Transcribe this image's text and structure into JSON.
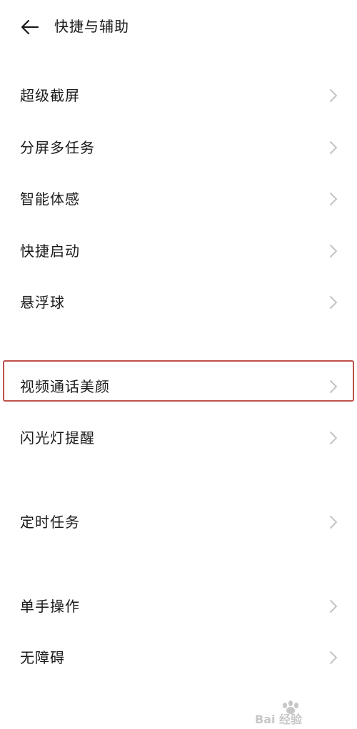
{
  "header": {
    "title": "快捷与辅助",
    "back_icon": "arrow-left-icon"
  },
  "items": [
    {
      "label": "超级截屏"
    },
    {
      "label": "分屏多任务"
    },
    {
      "label": "智能体感"
    },
    {
      "label": "快捷启动"
    },
    {
      "label": "悬浮球"
    },
    {
      "label": "视频通话美颜"
    },
    {
      "label": "闪光灯提醒"
    },
    {
      "label": "定时任务"
    },
    {
      "label": "单手操作"
    },
    {
      "label": "无障碍"
    }
  ],
  "chevron_icon": "chevron-right-icon",
  "colors": {
    "text": "#1a1a1a",
    "chevron": "#c4c4c4",
    "highlight_border": "#c0504d",
    "background": "#ffffff"
  },
  "watermark": {
    "text": "Bai 经验"
  }
}
